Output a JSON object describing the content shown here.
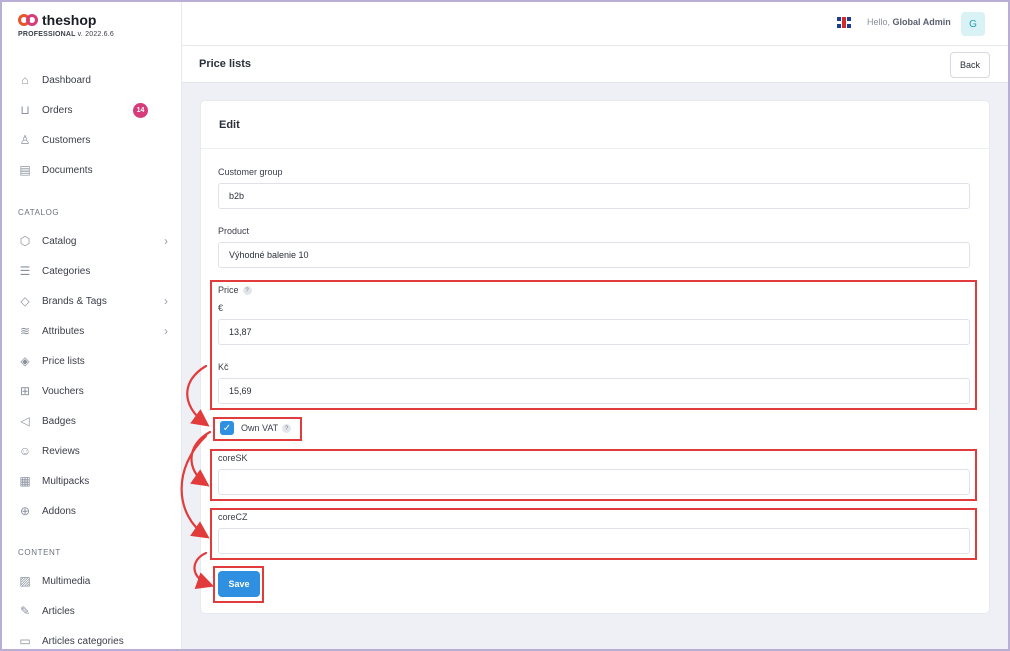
{
  "brand": {
    "name": "theshop",
    "edition": "PROFESSIONAL",
    "version": "v. 2022.6.6"
  },
  "sidebar": {
    "items": [
      {
        "label": "Dashboard",
        "icon": "home-icon"
      },
      {
        "label": "Orders",
        "icon": "cart-icon",
        "badge": "14"
      },
      {
        "label": "Customers",
        "icon": "user-icon"
      },
      {
        "label": "Documents",
        "icon": "document-icon"
      }
    ],
    "catalog_label": "CATALOG",
    "catalog_items": [
      {
        "label": "Catalog",
        "icon": "box-icon"
      },
      {
        "label": "Categories",
        "icon": "list-icon"
      },
      {
        "label": "Brands & Tags",
        "icon": "tag-icon"
      },
      {
        "label": "Attributes",
        "icon": "layers-icon"
      },
      {
        "label": "Price lists",
        "icon": "price-tag-icon"
      },
      {
        "label": "Vouchers",
        "icon": "gift-icon"
      },
      {
        "label": "Badges",
        "icon": "megaphone-icon"
      },
      {
        "label": "Reviews",
        "icon": "smile-icon"
      },
      {
        "label": "Multipacks",
        "icon": "stack-icon"
      },
      {
        "label": "Addons",
        "icon": "plus-circle-icon"
      }
    ],
    "content_label": "CONTENT",
    "content_items": [
      {
        "label": "Multimedia",
        "icon": "image-icon"
      },
      {
        "label": "Articles",
        "icon": "edit-icon"
      },
      {
        "label": "Articles categories",
        "icon": "folder-icon"
      }
    ]
  },
  "header": {
    "greeting": "Hello,",
    "user": "Global Admin",
    "avatar_initial": "G"
  },
  "page": {
    "title": "Price lists",
    "back_label": "Back"
  },
  "form": {
    "title": "Edit",
    "customer_group": {
      "label": "Customer group",
      "value": "b2b"
    },
    "product": {
      "label": "Product",
      "value": "Výhodné balenie 10"
    },
    "price": {
      "label": "Price",
      "help": "?",
      "eur": {
        "currency": "€",
        "value": "13,87"
      },
      "czk": {
        "currency": "Kč",
        "value": "15,69"
      }
    },
    "own_vat": {
      "label": "Own VAT",
      "help": "?",
      "checked": true
    },
    "core_sk": {
      "label": "coreSK",
      "value": ""
    },
    "core_cz": {
      "label": "coreCZ",
      "value": ""
    },
    "save_label": "Save"
  },
  "colors": {
    "accent": "#2f8fe0",
    "highlight": "#e23b3b",
    "badge": "#d63b7a",
    "brand": "#e8562c"
  }
}
